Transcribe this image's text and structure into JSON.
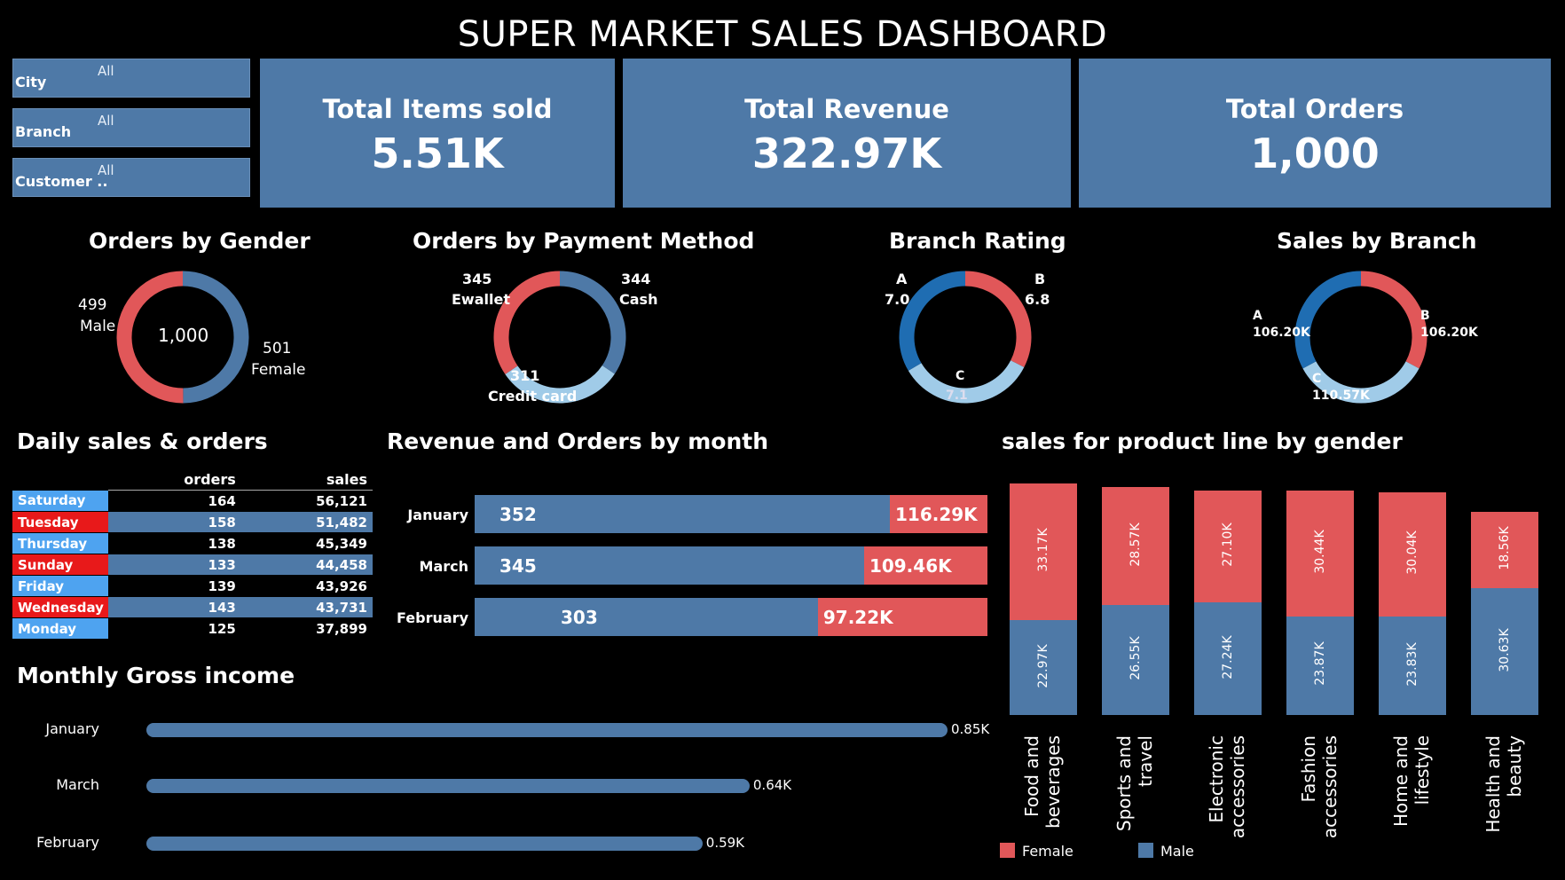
{
  "title": "SUPER MARKET SALES DASHBOARD",
  "filters": [
    {
      "label": "City",
      "value": "All"
    },
    {
      "label": "Branch",
      "value": "All"
    },
    {
      "label": "Customer ..",
      "value": "All"
    }
  ],
  "kpis": [
    {
      "label": "Total Items sold",
      "value": "5.51K"
    },
    {
      "label": "Total Revenue",
      "value": "322.97K"
    },
    {
      "label": "Total Orders",
      "value": "1,000"
    }
  ],
  "colors": {
    "blue": "#4e79a7",
    "red": "#e15759",
    "lightblue": "#a0cbe8",
    "darkblue": "#1f6db2",
    "day_blue": "#4ea3f0",
    "day_red": "#e8191a"
  },
  "chart_data": [
    {
      "type": "pie",
      "title": "Orders by Gender",
      "center_label": "1,000",
      "slices": [
        {
          "name": "Male",
          "value": 499,
          "label": "499",
          "color": "#4e79a7"
        },
        {
          "name": "Female",
          "value": 501,
          "label": "501",
          "color": "#e15759"
        }
      ]
    },
    {
      "type": "pie",
      "title": "Orders by Payment Method",
      "slices": [
        {
          "name": "Cash",
          "value": 344,
          "label": "344",
          "color": "#4e79a7"
        },
        {
          "name": "Credit card",
          "value": 311,
          "label": "311",
          "color": "#a0cbe8"
        },
        {
          "name": "Ewallet",
          "value": 345,
          "label": "345",
          "color": "#e15759"
        }
      ]
    },
    {
      "type": "pie",
      "title": "Branch Rating",
      "slices": [
        {
          "name": "B",
          "value": 6.8,
          "label": "6.8",
          "color": "#e15759"
        },
        {
          "name": "C",
          "value": 7.1,
          "label": "7.1",
          "color": "#a0cbe8"
        },
        {
          "name": "A",
          "value": 7.0,
          "label": "7.0",
          "color": "#1f6db2"
        }
      ]
    },
    {
      "type": "pie",
      "title": "Sales by Branch",
      "slices": [
        {
          "name": "B",
          "value": 106.2,
          "label": "106.20K",
          "color": "#e15759"
        },
        {
          "name": "C",
          "value": 110.57,
          "label": "110.57K",
          "color": "#a0cbe8"
        },
        {
          "name": "A",
          "value": 106.2,
          "label": "106.20K",
          "color": "#1f6db2"
        }
      ]
    },
    {
      "type": "table",
      "title": "Daily sales & orders",
      "columns": [
        "",
        "orders",
        "sales"
      ],
      "rows": [
        {
          "day": "Saturday",
          "orders": "164",
          "sales": "56,121",
          "color": "#4ea3f0"
        },
        {
          "day": "Tuesday",
          "orders": "158",
          "sales": "51,482",
          "color": "#e8191a"
        },
        {
          "day": "Thursday",
          "orders": "138",
          "sales": "45,349",
          "color": "#4ea3f0"
        },
        {
          "day": "Sunday",
          "orders": "133",
          "sales": "44,458",
          "color": "#e8191a"
        },
        {
          "day": "Friday",
          "orders": "139",
          "sales": "43,926",
          "color": "#4ea3f0"
        },
        {
          "day": "Wednesday",
          "orders": "143",
          "sales": "43,731",
          "color": "#e8191a"
        },
        {
          "day": "Monday",
          "orders": "125",
          "sales": "37,899",
          "color": "#4ea3f0"
        }
      ]
    },
    {
      "type": "bar",
      "title": "Revenue and Orders by month",
      "categories": [
        "January",
        "March",
        "February"
      ],
      "series": [
        {
          "name": "Orders",
          "values": [
            352,
            345,
            303
          ],
          "labels": [
            "352",
            "345",
            "303"
          ],
          "color": "#4e79a7"
        },
        {
          "name": "Revenue",
          "values": [
            116.29,
            109.46,
            97.22
          ],
          "labels": [
            "116.29K",
            "109.46K",
            "97.22K"
          ],
          "color": "#e15759"
        }
      ]
    },
    {
      "type": "bar",
      "title": "Monthly Gross income",
      "categories": [
        "January",
        "March",
        "February"
      ],
      "values": [
        0.85,
        0.64,
        0.59
      ],
      "labels": [
        "0.85K",
        "0.64K",
        "0.59K"
      ]
    },
    {
      "type": "bar",
      "title": "sales for product line  by gender",
      "categories": [
        "Food and\nbeverages",
        "Sports and\ntravel",
        "Electronic\naccessories",
        "Fashion\naccessories",
        "Home and\nlifestyle",
        "Health and\nbeauty"
      ],
      "series": [
        {
          "name": "Male",
          "values": [
            22.97,
            26.55,
            27.24,
            23.87,
            23.83,
            30.63
          ],
          "labels": [
            "22.97K",
            "26.55K",
            "27.24K",
            "23.87K",
            "23.83K",
            "30.63K"
          ],
          "color": "#4e79a7"
        },
        {
          "name": "Female",
          "values": [
            33.17,
            28.57,
            27.1,
            30.44,
            30.04,
            18.56
          ],
          "labels": [
            "33.17K",
            "28.57K",
            "27.10K",
            "30.44K",
            "30.04K",
            "18.56K"
          ],
          "color": "#e15759"
        }
      ],
      "legend": [
        "Female",
        "Male"
      ]
    }
  ]
}
